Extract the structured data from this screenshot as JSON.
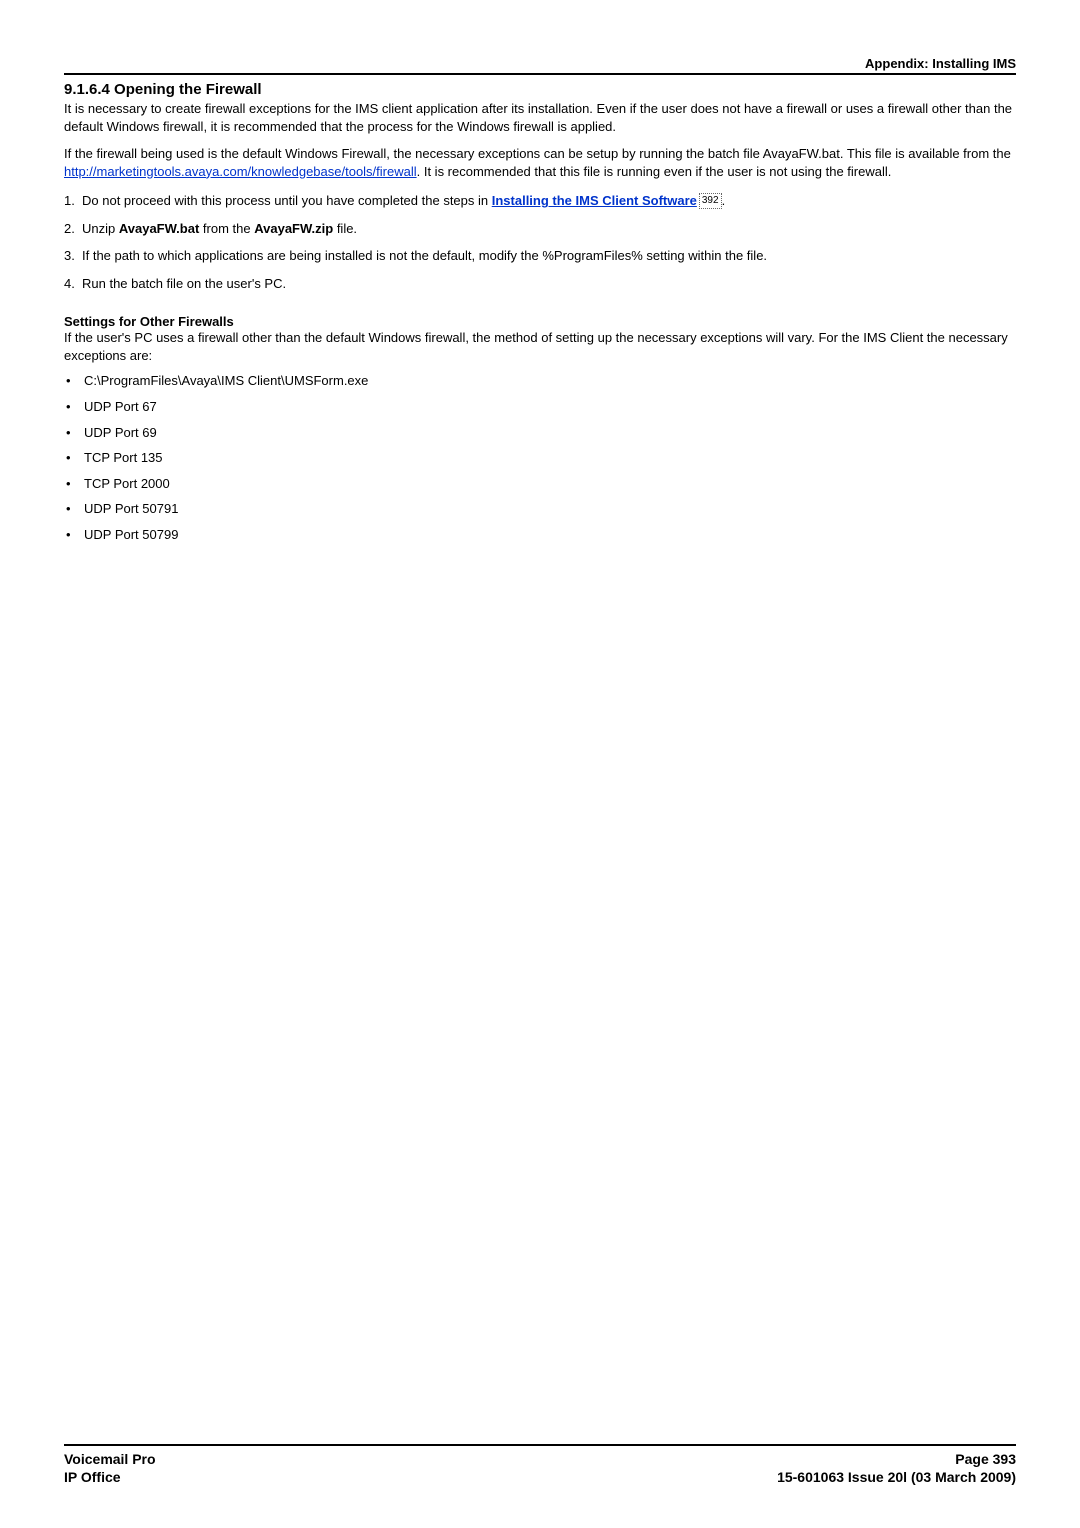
{
  "header": {
    "appendix": "Appendix: Installing IMS"
  },
  "section": {
    "number": "9.1.6.4",
    "title": "Opening the Firewall"
  },
  "p1": "It is necessary to create firewall exceptions for the IMS client application after its installation. Even if the user does not have a firewall or uses a firewall other than the default Windows firewall, it is recommended that the process for the Windows firewall is applied.",
  "p2a": "If the firewall being used is the default Windows Firewall, the necessary exceptions can be setup by running the batch file AvayaFW.bat. This file is available from the ",
  "p2_link": "http://marketingtools.avaya.com/knowledgebase/tools/firewall",
  "p2b": ". It is recommended that this file is running even if the user is not using the firewall.",
  "steps": {
    "s1a": "Do not proceed with this process until you have completed the steps in ",
    "s1_xref": "Installing the IMS Client Software",
    "s1_ref": "392",
    "s1b": ".",
    "s2a": "Unzip ",
    "s2b1": "AvayaFW.bat",
    "s2c": " from the ",
    "s2b2": "AvayaFW.zip",
    "s2d": " file.",
    "s3": "If the path to which applications are being installed is not the default, modify the %ProgramFiles% setting within the file.",
    "s4": "Run the batch file on the user's PC."
  },
  "other": {
    "heading": "Settings for Other Firewalls",
    "text": "If the user's PC uses a firewall other than the default Windows firewall, the method of setting up the necessary exceptions will vary. For the IMS Client the necessary exceptions are:",
    "items": [
      "C:\\ProgramFiles\\Avaya\\IMS Client\\UMSForm.exe",
      "UDP Port 67",
      "UDP Port 69",
      "TCP Port 135",
      "TCP Port 2000",
      "UDP Port 50791",
      "UDP Port 50799"
    ]
  },
  "footer": {
    "left1": "Voicemail Pro",
    "left2": "IP Office",
    "right1": "Page 393",
    "right2": "15-601063 Issue 20l (03 March 2009)"
  }
}
